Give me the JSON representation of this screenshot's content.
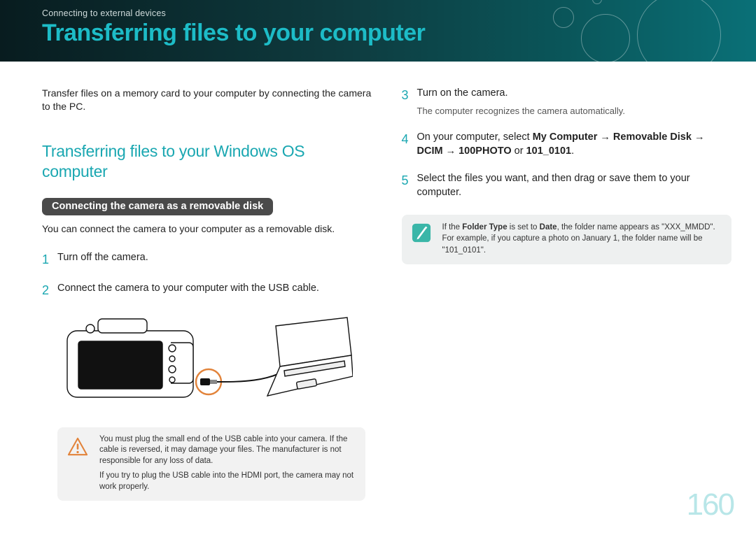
{
  "breadcrumb": "Connecting to external devices",
  "title": "Transferring files to your computer",
  "intro": "Transfer files on a memory card to your computer by connecting the camera to the PC.",
  "section_head": "Transferring files to your Windows OS computer",
  "subsection": {
    "pill": "Connecting the camera as a removable disk",
    "desc": "You can connect the camera to your computer as a removable disk."
  },
  "steps_left": [
    {
      "n": "1",
      "text": "Turn off the camera."
    },
    {
      "n": "2",
      "text": "Connect the camera to your computer with the USB cable."
    }
  ],
  "caution": {
    "p1": "You must plug the small end of the USB cable into your camera. If the cable is reversed, it may damage your files. The manufacturer is not responsible for any loss of data.",
    "p2": "If you try to plug the USB cable into the HDMI port, the camera may not work properly."
  },
  "steps_right": [
    {
      "n": "3",
      "text": "Turn on the camera.",
      "note": "The computer recognizes the camera automatically."
    },
    {
      "n": "4",
      "prefix": "On your computer, select ",
      "bold": "My Computer → Removable Disk → DCIM → 100PHOTO",
      "mid": " or ",
      "bold2": "101_0101",
      "suffix": "."
    },
    {
      "n": "5",
      "text": "Select the files you want, and then drag or save them to your computer."
    }
  ],
  "note": {
    "t1a": "If the ",
    "t1b": "Folder Type",
    "t1c": " is set to ",
    "t1d": "Date",
    "t1e": ", the folder name appears as \"XXX_MMDD\". For example, if you capture a photo on January 1, the folder name will be \"101_0101\"."
  },
  "page_number": "160",
  "colors": {
    "accent": "#1aa7b1",
    "title": "#1dbcc7",
    "warn": "#e2833a",
    "pen": "#3ab6a8"
  }
}
